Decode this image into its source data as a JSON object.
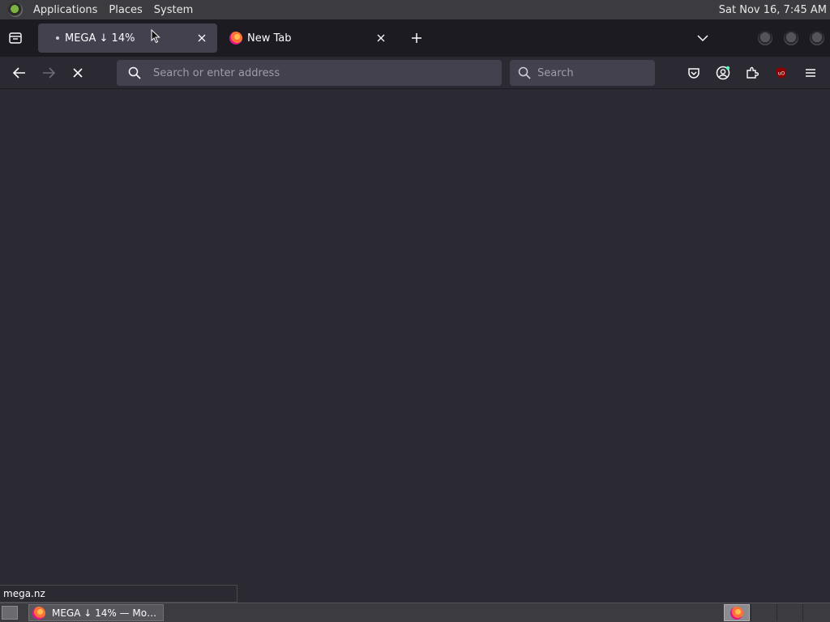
{
  "top_panel": {
    "menus": [
      "Applications",
      "Places",
      "System"
    ],
    "clock": "Sat Nov 16,  7:45 AM"
  },
  "tabs": [
    {
      "label": "MEGA ↓ 14%",
      "active": true
    },
    {
      "label": "New Tab",
      "active": false
    }
  ],
  "navbar": {
    "url_placeholder": "Search or enter address",
    "search_placeholder": "Search"
  },
  "status_link": "mega.nz",
  "taskbar": {
    "task_label": "MEGA ↓ 14% — Mo…"
  },
  "colors": {
    "page_bg": "#2b2a33",
    "tabbar_bg": "#1c1b22",
    "field_bg": "#42414d",
    "ublock_red": "#8b0000"
  }
}
